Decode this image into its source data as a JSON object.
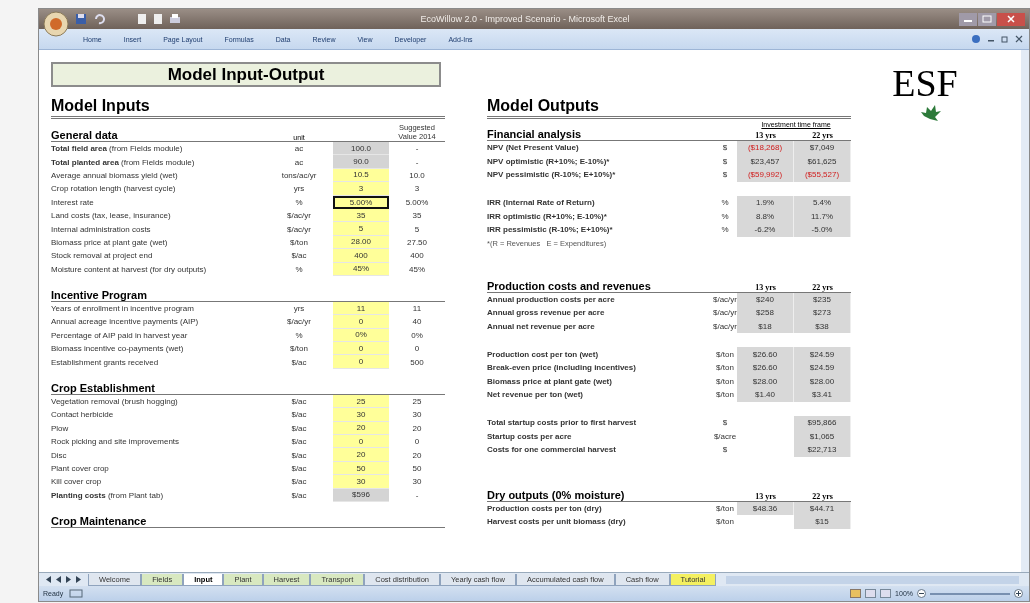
{
  "window": {
    "title": "EcoWillow 2.0 - Improved Scenario - Microsoft Excel"
  },
  "ribbon_tabs": [
    {
      "label": "Home"
    },
    {
      "label": "Insert"
    },
    {
      "label": "Page Layout"
    },
    {
      "label": "Formulas"
    },
    {
      "label": "Data"
    },
    {
      "label": "Review"
    },
    {
      "label": "View"
    },
    {
      "label": "Developer"
    },
    {
      "label": "Add-Ins"
    }
  ],
  "sheet": {
    "title": "Model Input-Output",
    "logo": "ESF",
    "inputs": {
      "heading": "Model Inputs",
      "unit_header": "unit",
      "suggested_header": "Suggested Value 2014",
      "sections": [
        {
          "heading": "General data",
          "rows": [
            {
              "label": "**Total field area** (from Fields module)",
              "unit": "ac",
              "value": "100.0",
              "kind": "computed",
              "selected": false,
              "suggested": "-"
            },
            {
              "label": "**Total planted area** (from Fields module)",
              "unit": "ac",
              "value": "90.0",
              "kind": "computed",
              "selected": false,
              "suggested": "-"
            },
            {
              "label": "Average annual biomass yield (wet)",
              "unit": "tons/ac/yr",
              "value": "10.5",
              "kind": "input",
              "selected": false,
              "suggested": "10.0"
            },
            {
              "label": "Crop rotation length (harvest cycle)",
              "unit": "yrs",
              "value": "3",
              "kind": "input",
              "selected": false,
              "suggested": "3"
            },
            {
              "label": "Interest rate",
              "unit": "%",
              "value": "5.00%",
              "kind": "input",
              "selected": true,
              "suggested": "5.00%"
            },
            {
              "label": "Land costs (tax, lease, insurance)",
              "unit": "$/ac/yr",
              "value": "35",
              "kind": "input",
              "selected": false,
              "suggested": "35"
            },
            {
              "label": "Internal administration costs",
              "unit": "$/ac/yr",
              "value": "5",
              "kind": "input",
              "selected": false,
              "suggested": "5"
            },
            {
              "label": "Biomass price at plant gate (wet)",
              "unit": "$/ton",
              "value": "28.00",
              "kind": "input",
              "selected": false,
              "suggested": "27.50"
            },
            {
              "label": "Stock removal at project end",
              "unit": "$/ac",
              "value": "400",
              "kind": "input",
              "selected": false,
              "suggested": "400"
            },
            {
              "label": "Moisture content at harvest (for dry outputs)",
              "unit": "%",
              "value": "45%",
              "kind": "input",
              "selected": false,
              "suggested": "45%"
            }
          ]
        },
        {
          "heading": "Incentive Program",
          "rows": [
            {
              "label": "Years of enrollment in incentive program",
              "unit": "yrs",
              "value": "11",
              "kind": "input",
              "selected": false,
              "suggested": "11"
            },
            {
              "label": "Annual acreage incentive payments (AIP)",
              "unit": "$/ac/yr",
              "value": "0",
              "kind": "input",
              "selected": false,
              "suggested": "40"
            },
            {
              "label": "Percentage of AIP paid in harvest year",
              "unit": "%",
              "value": "0%",
              "kind": "input",
              "selected": false,
              "suggested": "0%"
            },
            {
              "label": "Biomass incentive co-payments (wet)",
              "unit": "$/ton",
              "value": "0",
              "kind": "input",
              "selected": false,
              "suggested": "0"
            },
            {
              "label": "Establishment grants received",
              "unit": "$/ac",
              "value": "0",
              "kind": "input",
              "selected": false,
              "suggested": "500"
            }
          ]
        },
        {
          "heading": "Crop Establishment",
          "rows": [
            {
              "label": "Vegetation removal (brush hogging)",
              "unit": "$/ac",
              "value": "25",
              "kind": "input",
              "selected": false,
              "suggested": "25"
            },
            {
              "label": "Contact herbicide",
              "unit": "$/ac",
              "value": "30",
              "kind": "input",
              "selected": false,
              "suggested": "30"
            },
            {
              "label": "Plow",
              "unit": "$/ac",
              "value": "20",
              "kind": "input",
              "selected": false,
              "suggested": "20"
            },
            {
              "label": "Rock picking and site improvements",
              "unit": "$/ac",
              "value": "0",
              "kind": "input",
              "selected": false,
              "suggested": "0"
            },
            {
              "label": "Disc",
              "unit": "$/ac",
              "value": "20",
              "kind": "input",
              "selected": false,
              "suggested": "20"
            },
            {
              "label": "Plant cover crop",
              "unit": "$/ac",
              "value": "50",
              "kind": "input",
              "selected": false,
              "suggested": "50"
            },
            {
              "label": "Kill cover crop",
              "unit": "$/ac",
              "value": "30",
              "kind": "input",
              "selected": false,
              "suggested": "30"
            },
            {
              "label": "**Planting costs** (from Plant tab)",
              "unit": "$/ac",
              "value": "$596",
              "kind": "computed",
              "selected": false,
              "suggested": "-"
            }
          ]
        },
        {
          "heading": "Crop Maintenance"
        }
      ]
    },
    "outputs": {
      "heading": "Model Outputs",
      "sections": [
        {
          "heading": "Financial analysis",
          "caption": "Investment time frame",
          "columns": [
            "13 yrs",
            "22 yrs"
          ],
          "groups": [
            [
              {
                "label": "NPV (Net Present Value)",
                "unit": "$",
                "values": [
                  {
                    "text": "($18,268)",
                    "negative": true
                  },
                  {
                    "text": "$7,049",
                    "negative": false
                  }
                ]
              },
              {
                "label": "NPV optimistic (R+10%; E-10%)*",
                "unit": "$",
                "values": [
                  {
                    "text": "$23,457",
                    "negative": false
                  },
                  {
                    "text": "$61,625",
                    "negative": false
                  }
                ]
              },
              {
                "label": "NPV pessimistic (R-10%; E+10%)*",
                "unit": "$",
                "values": [
                  {
                    "text": "($59,992)",
                    "negative": true
                  },
                  {
                    "text": "($55,527)",
                    "negative": true
                  }
                ]
              }
            ],
            [
              {
                "label": "IRR (Internal Rate of Return)",
                "unit": "%",
                "values": [
                  {
                    "text": "1.9%",
                    "negative": false
                  },
                  {
                    "text": "5.4%",
                    "negative": false
                  }
                ]
              },
              {
                "label": "IRR optimistic (R+10%; E-10%)*",
                "unit": "%",
                "values": [
                  {
                    "text": "8.8%",
                    "negative": false
                  },
                  {
                    "text": "11.7%",
                    "negative": false
                  }
                ]
              },
              {
                "label": "IRR pessimistic (R-10%; E+10%)*",
                "unit": "%",
                "values": [
                  {
                    "text": "-6.2%",
                    "negative": false
                  },
                  {
                    "text": "-5.0%",
                    "negative": false
                  }
                ]
              }
            ]
          ],
          "footnote": "*(R = Revenues   E = Expenditures)"
        },
        {
          "heading": "Production costs and revenues",
          "columns": [
            "13 yrs",
            "22 yrs"
          ],
          "groups": [
            [
              {
                "label": "Annual production costs per acre",
                "unit": "$/ac/yr",
                "values": [
                  {
                    "text": "$240",
                    "negative": false
                  },
                  {
                    "text": "$235",
                    "negative": false
                  }
                ]
              },
              {
                "label": "Annual gross revenue per acre",
                "unit": "$/ac/yr",
                "values": [
                  {
                    "text": "$258",
                    "negative": false
                  },
                  {
                    "text": "$273",
                    "negative": false
                  }
                ]
              },
              {
                "label": "Annual net revenue per acre",
                "unit": "$/ac/yr",
                "values": [
                  {
                    "text": "$18",
                    "negative": false
                  },
                  {
                    "text": "$38",
                    "negative": false
                  }
                ]
              }
            ],
            [
              {
                "label": "Production cost per ton (wet)",
                "unit": "$/ton",
                "values": [
                  {
                    "text": "$26.60",
                    "negative": false
                  },
                  {
                    "text": "$24.59",
                    "negative": false
                  }
                ]
              },
              {
                "label": "Break-even price (including incentives)",
                "unit": "$/ton",
                "values": [
                  {
                    "text": "$26.60",
                    "negative": false
                  },
                  {
                    "text": "$24.59",
                    "negative": false
                  }
                ]
              },
              {
                "label": "Biomass price at plant gate (wet)",
                "unit": "$/ton",
                "values": [
                  {
                    "text": "$28.00",
                    "negative": false
                  },
                  {
                    "text": "$28.00",
                    "negative": false
                  }
                ]
              },
              {
                "label": "Net revenue per ton (wet)",
                "unit": "$/ton",
                "values": [
                  {
                    "text": "$1.40",
                    "negative": false
                  },
                  {
                    "text": "$3.41",
                    "negative": false
                  }
                ]
              }
            ],
            [
              {
                "label": "Total startup costs prior to first harvest",
                "unit": "$",
                "kind": "last_only",
                "values": [
                  {
                    "text": "$95,866",
                    "negative": false
                  }
                ]
              },
              {
                "label": "Startup costs per acre",
                "unit": "$/acre",
                "kind": "last_only",
                "values": [
                  {
                    "text": "$1,065",
                    "negative": false
                  }
                ]
              },
              {
                "label": "Costs for one commercial harvest",
                "unit": "$",
                "kind": "last_only",
                "values": [
                  {
                    "text": "$22,713",
                    "negative": false
                  }
                ]
              }
            ]
          ]
        },
        {
          "heading": "Dry outputs (0% moisture)",
          "columns": [
            "13 yrs",
            "22 yrs"
          ],
          "groups": [
            [
              {
                "label": "Production costs per ton (dry)",
                "unit": "$/ton",
                "values": [
                  {
                    "text": "$48.36",
                    "negative": false
                  },
                  {
                    "text": "$44.71",
                    "negative": false
                  }
                ]
              },
              {
                "label": "Harvest costs per unit biomass (dry)",
                "unit": "$/ton",
                "kind": "last_only",
                "values": [
                  {
                    "text": "$15",
                    "negative": false
                  }
                ]
              }
            ]
          ]
        }
      ]
    }
  },
  "sheet_tabs": [
    {
      "label": "Welcome",
      "selected": false,
      "color": "#dfe6ef"
    },
    {
      "label": "Fields",
      "selected": false,
      "color": "#d8e8c0"
    },
    {
      "label": "Input",
      "selected": true,
      "color": "#ffffff"
    },
    {
      "label": "Plant",
      "selected": false,
      "color": "#d8e8c0"
    },
    {
      "label": "Harvest",
      "selected": false,
      "color": "#d8e8c0"
    },
    {
      "label": "Transport",
      "selected": false,
      "color": "#d8e8c0"
    },
    {
      "label": "Cost distribution",
      "selected": false,
      "color": "#dfe6ef"
    },
    {
      "label": "Yearly cash flow",
      "selected": false,
      "color": "#dfe6ef"
    },
    {
      "label": "Accumulated cash flow",
      "selected": false,
      "color": "#dfe6ef"
    },
    {
      "label": "Cash flow",
      "selected": false,
      "color": "#dfe6ef"
    },
    {
      "label": "Tutorial",
      "selected": false,
      "color": "#f4f060"
    }
  ],
  "status_bar": {
    "status": "Ready",
    "zoom": "100%"
  }
}
